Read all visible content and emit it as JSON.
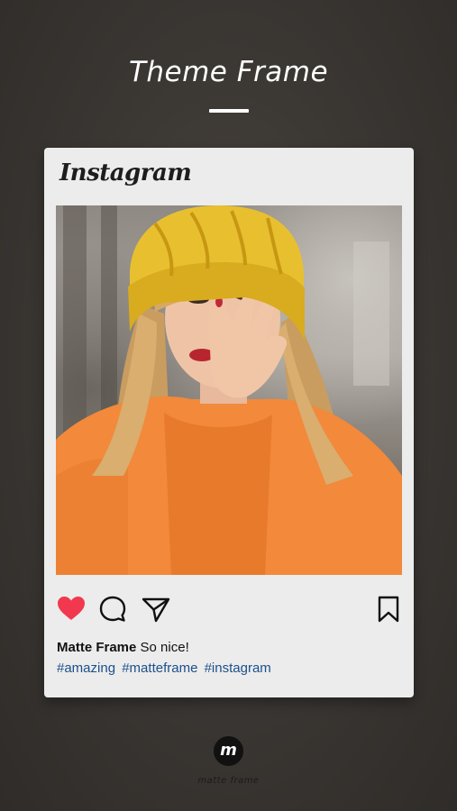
{
  "header": {
    "title": "Theme Frame"
  },
  "post": {
    "brand": "Instagram",
    "actions": {
      "like_icon": "heart-filled-icon",
      "comment_icon": "comment-icon",
      "share_icon": "send-icon",
      "save_icon": "bookmark-icon"
    },
    "caption": {
      "user": "Matte Frame",
      "text": "So nice!"
    },
    "hashtags": [
      "#amazing",
      "#matteframe",
      "#instagram"
    ],
    "colors": {
      "like": "#f2384f",
      "hashtag": "#1c4f8c"
    }
  },
  "footer": {
    "logo_letter": "m",
    "brand": "matte frame"
  }
}
